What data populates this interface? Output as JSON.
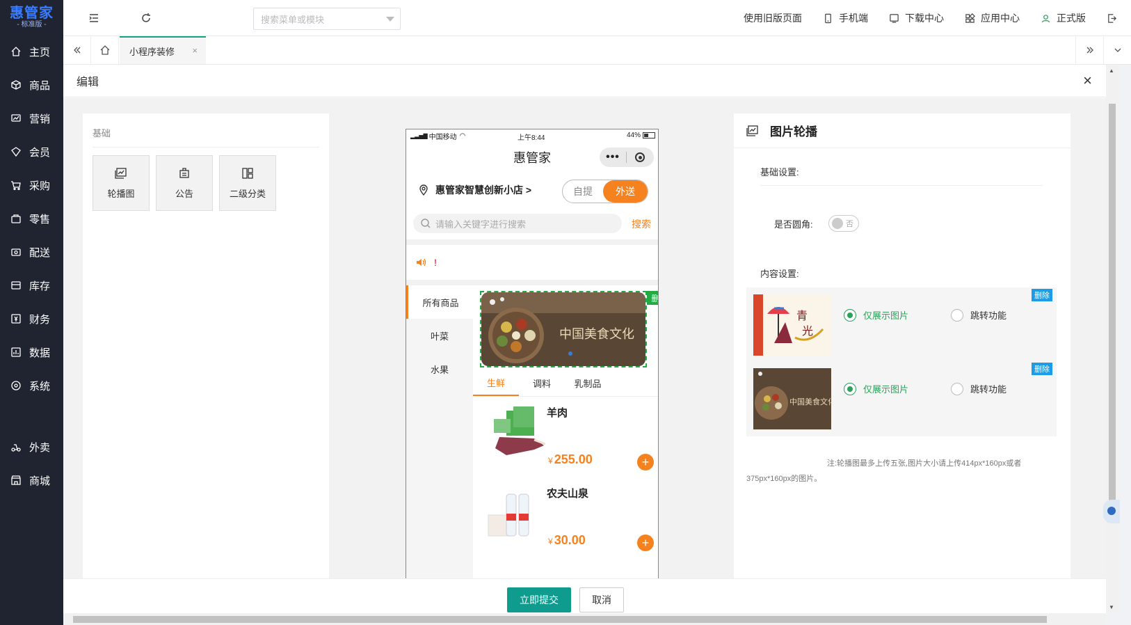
{
  "app": {
    "logo_main": "惠管家",
    "logo_sub": "- 标准版 -"
  },
  "sidebar": {
    "items": [
      {
        "label": "主页",
        "icon": "home-icon"
      },
      {
        "label": "商品",
        "icon": "box-icon"
      },
      {
        "label": "营销",
        "icon": "marketing-icon"
      },
      {
        "label": "会员",
        "icon": "member-icon"
      },
      {
        "label": "采购",
        "icon": "purchase-icon"
      },
      {
        "label": "零售",
        "icon": "retail-icon"
      },
      {
        "label": "配送",
        "icon": "delivery-icon"
      },
      {
        "label": "库存",
        "icon": "inventory-icon"
      },
      {
        "label": "财务",
        "icon": "finance-icon"
      },
      {
        "label": "数据",
        "icon": "chart-icon"
      },
      {
        "label": "系统",
        "icon": "system-icon"
      },
      {
        "label": "外卖",
        "icon": "takeout-icon"
      },
      {
        "label": "商城",
        "icon": "mall-icon"
      }
    ]
  },
  "header": {
    "search_placeholder": "搜索菜单或模块",
    "old_page": "使用旧版页面",
    "mobile": "手机端",
    "download": "下载中心",
    "apps": "应用中心",
    "version": "正式版"
  },
  "tabs": {
    "active_label": "小程序装修"
  },
  "edit": {
    "title": "编辑",
    "library_title": "基础",
    "library_items": [
      "轮播图",
      "公告",
      "二级分类"
    ]
  },
  "phone": {
    "carrier": "中国移动",
    "time": "上午8:44",
    "battery": "44%",
    "app_title": "惠管家",
    "capsule_dots": "•••",
    "store_name": "惠管家智慧创新小店 >",
    "toggle_pickup": "自提",
    "toggle_delivery": "外送",
    "search_placeholder": "请输入关键字进行搜索",
    "search_btn": "搜索",
    "notice_text": "!",
    "categories": [
      "所有商品",
      "叶菜",
      "水果"
    ],
    "banner_delete": "删 除",
    "subtabs": [
      "生鲜",
      "调料",
      "乳制品"
    ],
    "products": [
      {
        "name": "羊肉",
        "currency": "¥",
        "price": "255.00"
      },
      {
        "name": "农夫山泉",
        "currency": "¥",
        "price": "30.00"
      }
    ]
  },
  "settings": {
    "title": "图片轮播",
    "basic_label": "基础设置:",
    "rounded_label": "是否圆角:",
    "rounded_value": "否",
    "content_label": "内容设置:",
    "rows": [
      {
        "option_show": "仅展示图片",
        "option_jump": "跳转功能",
        "delete": "删除",
        "selected": "show"
      },
      {
        "option_show": "仅展示图片",
        "option_jump": "跳转功能",
        "delete": "删除",
        "selected": "show"
      }
    ],
    "note": "注:轮播图最多上传五张,图片大小请上传414px*160px或者375px*160px的图片。"
  },
  "footer": {
    "submit": "立即提交",
    "cancel": "取消"
  },
  "colors": {
    "sidebar_bg": "#1f2430",
    "accent_green": "#0f9b8e",
    "orange": "#f5821f",
    "selection_green": "#22aa44"
  }
}
